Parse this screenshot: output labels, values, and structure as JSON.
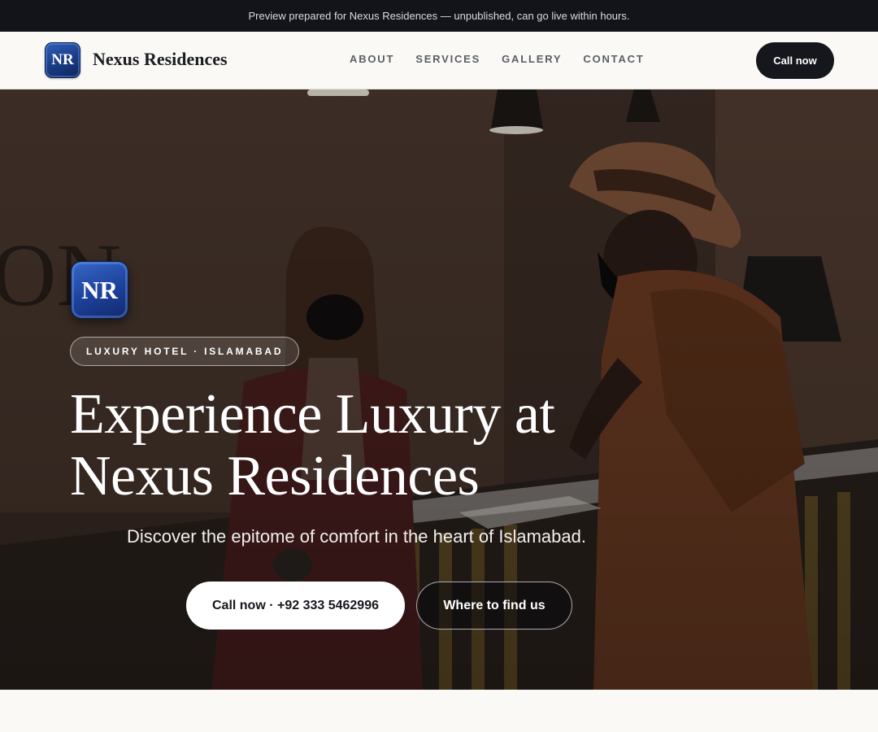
{
  "topbar": {
    "text": "Preview prepared for Nexus Residences — unpublished, can go live within hours."
  },
  "header": {
    "logo_initials": "NR",
    "brand_name": "Nexus Residences",
    "nav": [
      {
        "label": "ABOUT"
      },
      {
        "label": "SERVICES"
      },
      {
        "label": "GALLERY"
      },
      {
        "label": "CONTACT"
      }
    ],
    "call_label": "Call now"
  },
  "hero": {
    "logo_initials": "NR",
    "tag": "LUXURY HOTEL · ISLAMABAD",
    "title_line1": "Experience Luxury at",
    "title_line2": "Nexus Residences",
    "subtitle": "Discover the epitome of comfort in the heart of Islamabad.",
    "primary_button": "Call now · +92 333 5462996",
    "secondary_button": "Where to find us",
    "background_image": "hotel-reception-photo"
  },
  "colors": {
    "topbar_bg": "#121419",
    "page_bg": "#faf9f6",
    "dark_button": "#15171c",
    "logo_blue": "#1d409a"
  }
}
